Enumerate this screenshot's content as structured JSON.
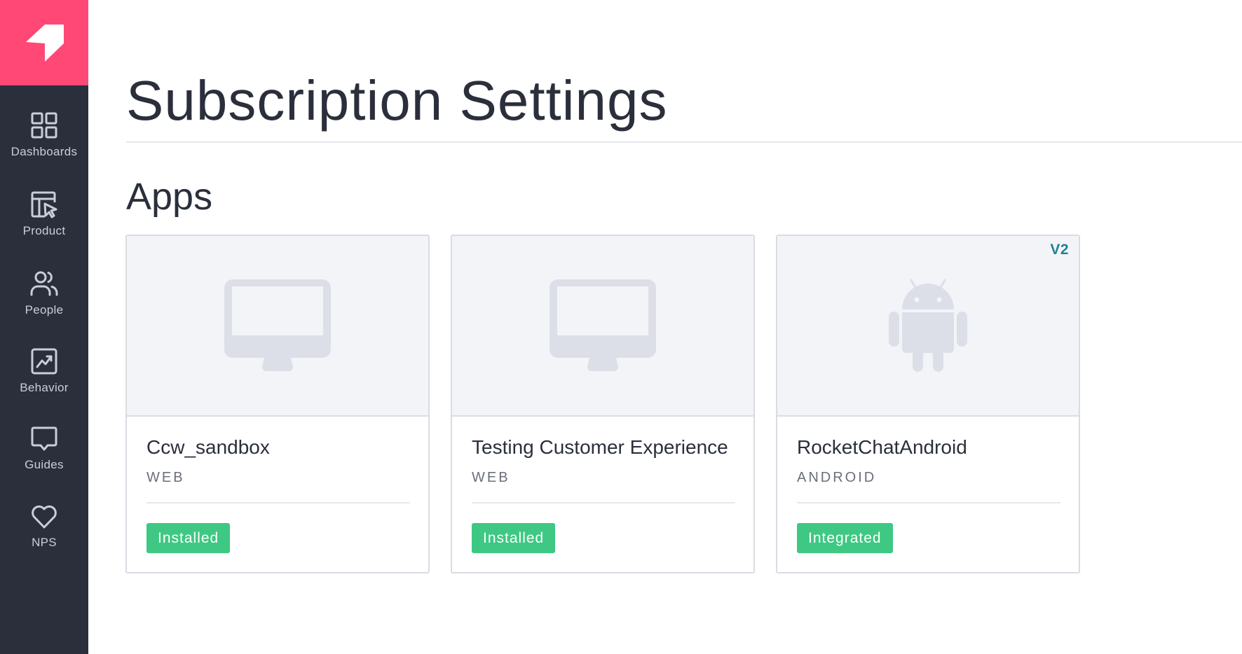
{
  "sidebar": {
    "items": [
      {
        "label": "Dashboards",
        "icon": "dashboards-icon"
      },
      {
        "label": "Product",
        "icon": "product-icon"
      },
      {
        "label": "People",
        "icon": "people-icon"
      },
      {
        "label": "Behavior",
        "icon": "behavior-icon"
      },
      {
        "label": "Guides",
        "icon": "guides-icon"
      },
      {
        "label": "NPS",
        "icon": "nps-icon"
      }
    ]
  },
  "page": {
    "title": "Subscription Settings",
    "section_title": "Apps"
  },
  "apps": [
    {
      "name": "Ccw_sandbox",
      "platform": "WEB",
      "status": "Installed",
      "badge": "",
      "icon": "monitor-icon"
    },
    {
      "name": "Testing Customer Experience",
      "platform": "WEB",
      "status": "Installed",
      "badge": "",
      "icon": "monitor-icon"
    },
    {
      "name": "RocketChatAndroid",
      "platform": "ANDROID",
      "status": "Integrated",
      "badge": "V2",
      "icon": "android-icon"
    }
  ],
  "colors": {
    "brand": "#ff4876",
    "sidebar": "#2a2f3b",
    "status_green": "#3ec883",
    "badge_teal": "#208195"
  }
}
